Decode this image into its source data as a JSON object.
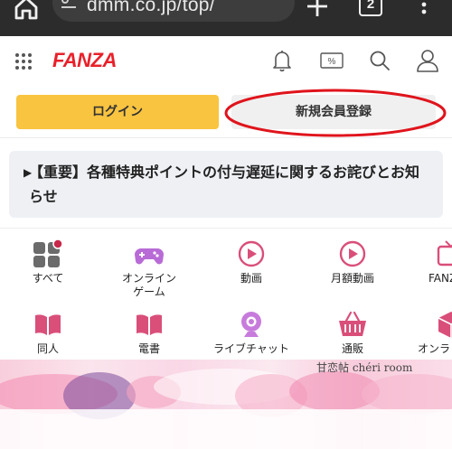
{
  "browser": {
    "url": "dmm.co.jp/top/",
    "tab_count": "2",
    "icons": [
      "home-icon",
      "url-info-icon",
      "plus-icon",
      "tabs-icon",
      "menu-icon"
    ]
  },
  "header": {
    "logo": "FANZA",
    "icons": [
      "grid-icon",
      "bell-icon",
      "coupon-icon",
      "search-icon",
      "user-icon"
    ],
    "coupon_glyph": "%"
  },
  "auth": {
    "login_label": "ログイン",
    "register_label": "新規会員登録"
  },
  "notice": {
    "text": "【重要】各種特典ポイントの付与遅延に関するお詫びとお知らせ"
  },
  "categories": [
    {
      "label": "すべて",
      "icon": "apps-icon"
    },
    {
      "label": "オンライン\nゲーム",
      "icon": "gamepad-icon"
    },
    {
      "label": "動画",
      "icon": "play-icon"
    },
    {
      "label": "月額動画",
      "icon": "play-icon"
    },
    {
      "label": "FANZ",
      "icon": "tv-icon"
    },
    {
      "label": "同人",
      "icon": "book-icon"
    },
    {
      "label": "電書",
      "icon": "book-icon"
    },
    {
      "label": "ライブチャット",
      "icon": "webcam-icon"
    },
    {
      "label": "通販",
      "icon": "basket-icon"
    },
    {
      "label": "オンラ",
      "icon": "cube-icon"
    }
  ],
  "banner": {
    "caption": "甘恋帖 chéri room"
  },
  "colors": {
    "brand_red": "#e8202a",
    "login_yellow": "#f9c440",
    "category_pink": "#d94f7a",
    "annotation_red": "#e0141c"
  }
}
